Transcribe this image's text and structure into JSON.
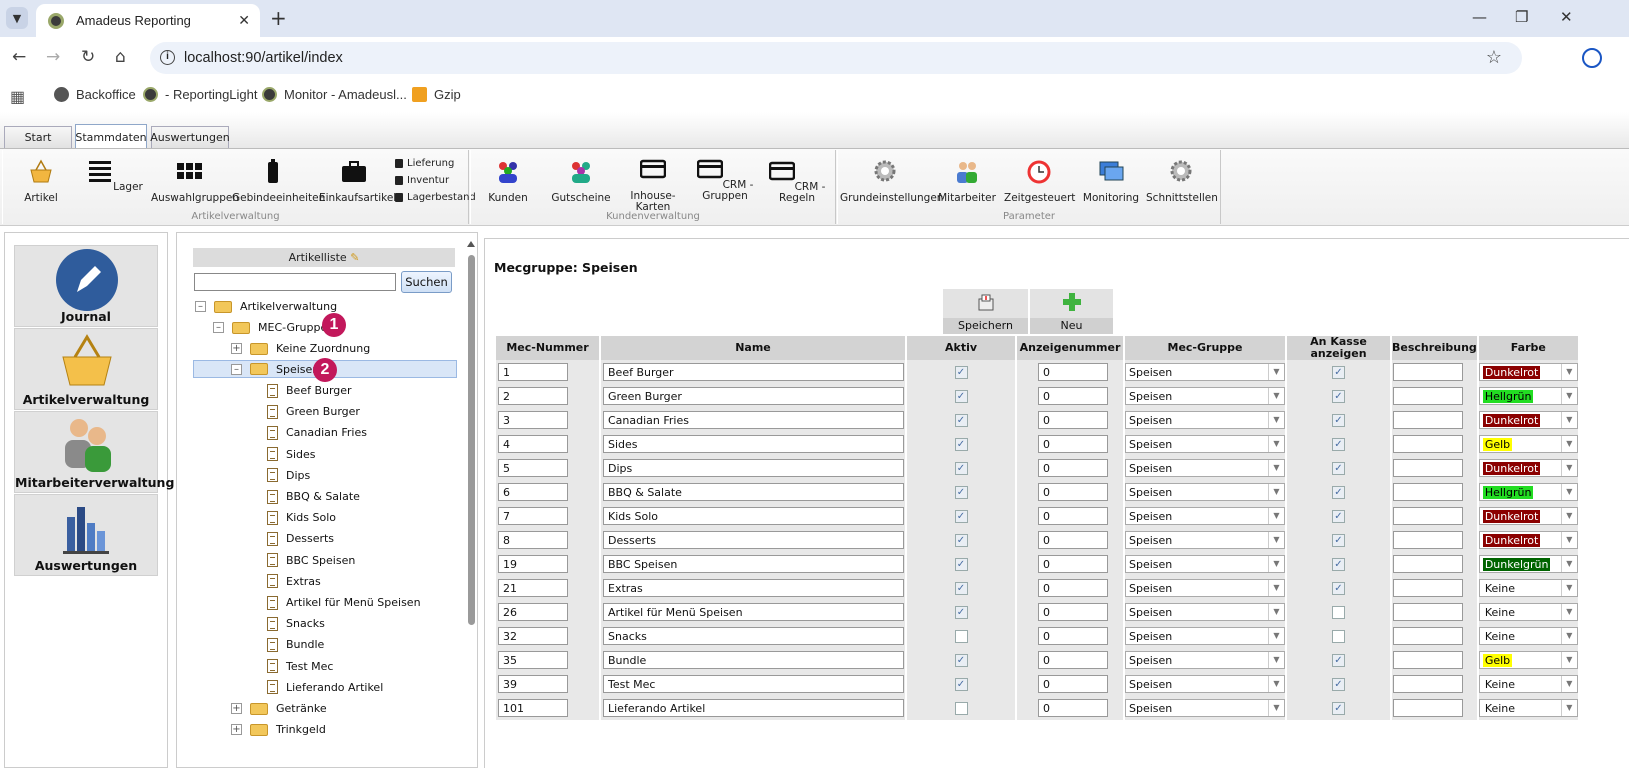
{
  "browser": {
    "tab_title": "Amadeus Reporting",
    "url": "localhost:90/artikel/index",
    "bookmarks": [
      "Backoffice",
      "- ReportingLight",
      "Monitor - Amadeusl...",
      "Gzip"
    ]
  },
  "ribbon": {
    "tabs": [
      "Start",
      "Stammdaten",
      "Auswertungen"
    ],
    "groups": {
      "artikel": {
        "label": "Artikelverwaltung",
        "buttons": [
          "Artikel",
          "Lager",
          "Auswahlgruppen",
          "Gebindeeinheiten",
          "Einkaufsartikel"
        ],
        "small": [
          "Lieferung",
          "Inventur",
          "Lagerbestand"
        ]
      },
      "kunden": {
        "label": "Kundenverwaltung",
        "buttons": [
          "Kunden",
          "Gutscheine",
          "Inhouse-\nKarten",
          "CRM -\nGruppen",
          "CRM - Regeln"
        ]
      },
      "param": {
        "label": "Parameter",
        "buttons": [
          "Grundeinstellungen",
          "Mitarbeiter",
          "Zeitgesteuert",
          "Monitoring",
          "Schnittstellen"
        ]
      }
    }
  },
  "leftnav": [
    "Journal",
    "Artikelverwaltung",
    "Mitarbeiterverwaltung",
    "Auswertungen"
  ],
  "tree": {
    "header": "Artikelliste",
    "search_button": "Suchen",
    "root": "Artikelverwaltung",
    "group": "MEC-Gruppen",
    "keine": "Keine Zuordnung",
    "speisen": "Speisen",
    "items": [
      "Beef Burger",
      "Green Burger",
      "Canadian Fries",
      "Sides",
      "Dips",
      "BBQ & Salate",
      "Kids Solo",
      "Desserts",
      "BBC Speisen",
      "Extras",
      "Artikel für Menü Speisen",
      "Snacks",
      "Bundle",
      "Test Mec",
      "Lieferando Artikel"
    ],
    "getraenke": "Getränke",
    "trinkgeld": "Trinkgeld",
    "badges": [
      "1",
      "2"
    ]
  },
  "main": {
    "title": "Mecgruppe: Speisen",
    "save_label": "Speichern",
    "new_label": "Neu",
    "columns": [
      "Mec-Nummer",
      "Name",
      "Aktiv",
      "Anzeigenummer",
      "Mec-Gruppe",
      "An Kasse anzeigen",
      "Beschreibung",
      "Farbe"
    ],
    "rows": [
      {
        "nr": "1",
        "name": "Beef Burger",
        "aktiv": true,
        "anz": "0",
        "gruppe": "Speisen",
        "kasse": true,
        "farbe": "Dunkelrot",
        "fc": "#8b0000",
        "ft": "#fff"
      },
      {
        "nr": "2",
        "name": "Green Burger",
        "aktiv": true,
        "anz": "0",
        "gruppe": "Speisen",
        "kasse": true,
        "farbe": "Hellgrün",
        "fc": "#22dd22",
        "ft": "#000"
      },
      {
        "nr": "3",
        "name": "Canadian Fries",
        "aktiv": true,
        "anz": "0",
        "gruppe": "Speisen",
        "kasse": true,
        "farbe": "Dunkelrot",
        "fc": "#8b0000",
        "ft": "#fff"
      },
      {
        "nr": "4",
        "name": "Sides",
        "aktiv": true,
        "anz": "0",
        "gruppe": "Speisen",
        "kasse": true,
        "farbe": "Gelb",
        "fc": "#ffff00",
        "ft": "#000"
      },
      {
        "nr": "5",
        "name": "Dips",
        "aktiv": true,
        "anz": "0",
        "gruppe": "Speisen",
        "kasse": true,
        "farbe": "Dunkelrot",
        "fc": "#8b0000",
        "ft": "#fff"
      },
      {
        "nr": "6",
        "name": "BBQ & Salate",
        "aktiv": true,
        "anz": "0",
        "gruppe": "Speisen",
        "kasse": true,
        "farbe": "Hellgrün",
        "fc": "#22dd22",
        "ft": "#000"
      },
      {
        "nr": "7",
        "name": "Kids Solo",
        "aktiv": true,
        "anz": "0",
        "gruppe": "Speisen",
        "kasse": true,
        "farbe": "Dunkelrot",
        "fc": "#8b0000",
        "ft": "#fff"
      },
      {
        "nr": "8",
        "name": "Desserts",
        "aktiv": true,
        "anz": "0",
        "gruppe": "Speisen",
        "kasse": true,
        "farbe": "Dunkelrot",
        "fc": "#8b0000",
        "ft": "#fff"
      },
      {
        "nr": "19",
        "name": "BBC Speisen",
        "aktiv": true,
        "anz": "0",
        "gruppe": "Speisen",
        "kasse": true,
        "farbe": "Dunkelgrün",
        "fc": "#006400",
        "ft": "#fff"
      },
      {
        "nr": "21",
        "name": "Extras",
        "aktiv": true,
        "anz": "0",
        "gruppe": "Speisen",
        "kasse": true,
        "farbe": "Keine",
        "fc": "",
        "ft": "#000"
      },
      {
        "nr": "26",
        "name": "Artikel für Menü Speisen",
        "aktiv": true,
        "anz": "0",
        "gruppe": "Speisen",
        "kasse": false,
        "farbe": "Keine",
        "fc": "",
        "ft": "#000"
      },
      {
        "nr": "32",
        "name": "Snacks",
        "aktiv": false,
        "anz": "0",
        "gruppe": "Speisen",
        "kasse": false,
        "farbe": "Keine",
        "fc": "",
        "ft": "#000"
      },
      {
        "nr": "35",
        "name": "Bundle",
        "aktiv": true,
        "anz": "0",
        "gruppe": "Speisen",
        "kasse": true,
        "farbe": "Gelb",
        "fc": "#ffff00",
        "ft": "#000"
      },
      {
        "nr": "39",
        "name": "Test Mec",
        "aktiv": true,
        "anz": "0",
        "gruppe": "Speisen",
        "kasse": true,
        "farbe": "Keine",
        "fc": "",
        "ft": "#000"
      },
      {
        "nr": "101",
        "name": "Lieferando Artikel",
        "aktiv": false,
        "anz": "0",
        "gruppe": "Speisen",
        "kasse": true,
        "farbe": "Keine",
        "fc": "",
        "ft": "#000"
      }
    ]
  }
}
